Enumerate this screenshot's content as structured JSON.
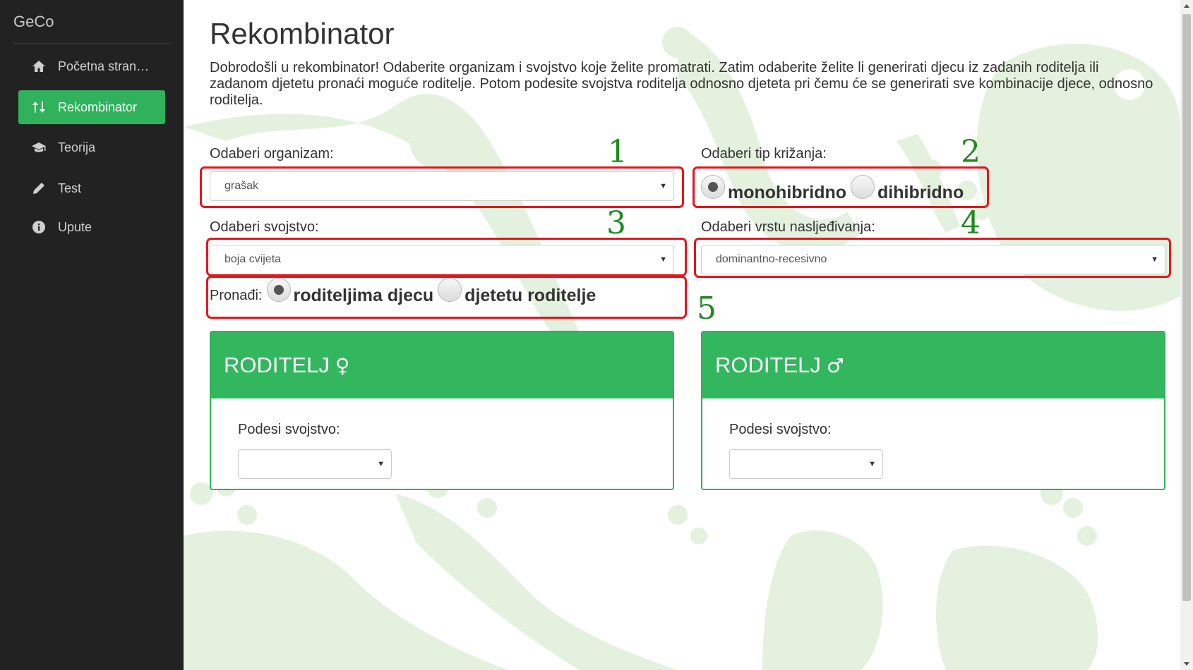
{
  "sidebar": {
    "brand": "GeCo",
    "items": [
      {
        "label": "Početna stran…",
        "icon": "home-icon",
        "active": false
      },
      {
        "label": "Rekombinator",
        "icon": "sort-arrows-icon",
        "active": true
      },
      {
        "label": "Teorija",
        "icon": "graduation-cap-icon",
        "active": false
      },
      {
        "label": "Test",
        "icon": "pencil-icon",
        "active": false
      },
      {
        "label": "Upute",
        "icon": "info-circle-icon",
        "active": false
      }
    ]
  },
  "main": {
    "title": "Rekombinator",
    "intro": "Dobrodošli u rekombinator! Odaberite organizam i svojstvo koje želite promatrati. Zatim odaberite želite li generirati djecu iz zadanih roditelja ili zadanom djetetu pronaći moguće roditelje. Potom podesite svojstva roditelja odnosno djeteta pri čemu će se generirati sve kombinacije djece, odnosno roditelja.",
    "organism": {
      "label": "Odaberi organizam:",
      "value": "grašak"
    },
    "cross_type": {
      "label": "Odaberi tip križanja:",
      "options": [
        "monohibridno",
        "dihibridno"
      ],
      "selected": "monohibridno"
    },
    "trait": {
      "label": "Odaberi svojstvo:",
      "value": "boja cvijeta"
    },
    "inheritance": {
      "label": "Odaberi vrstu nasljeđivanja:",
      "value": "dominantno-recesivno"
    },
    "find": {
      "label": "Pronađi:",
      "options": [
        "roditeljima djecu",
        "djetetu roditelje"
      ],
      "selected": "roditeljima djecu"
    },
    "annotations": [
      "1",
      "2",
      "3",
      "4",
      "5"
    ],
    "parent_female": {
      "title": "RODITELJ",
      "symbol": "♀",
      "field_label": "Podesi svojstvo:",
      "value": ""
    },
    "parent_male": {
      "title": "RODITELJ",
      "symbol": "♂",
      "field_label": "Podesi svojstvo:",
      "value": ""
    }
  },
  "colors": {
    "accent": "#32b65e",
    "sidebar_bg": "#222222",
    "annotation_box": "#e8141b",
    "annotation_number": "#1f8a1f",
    "background_art": "#e3f1de"
  }
}
